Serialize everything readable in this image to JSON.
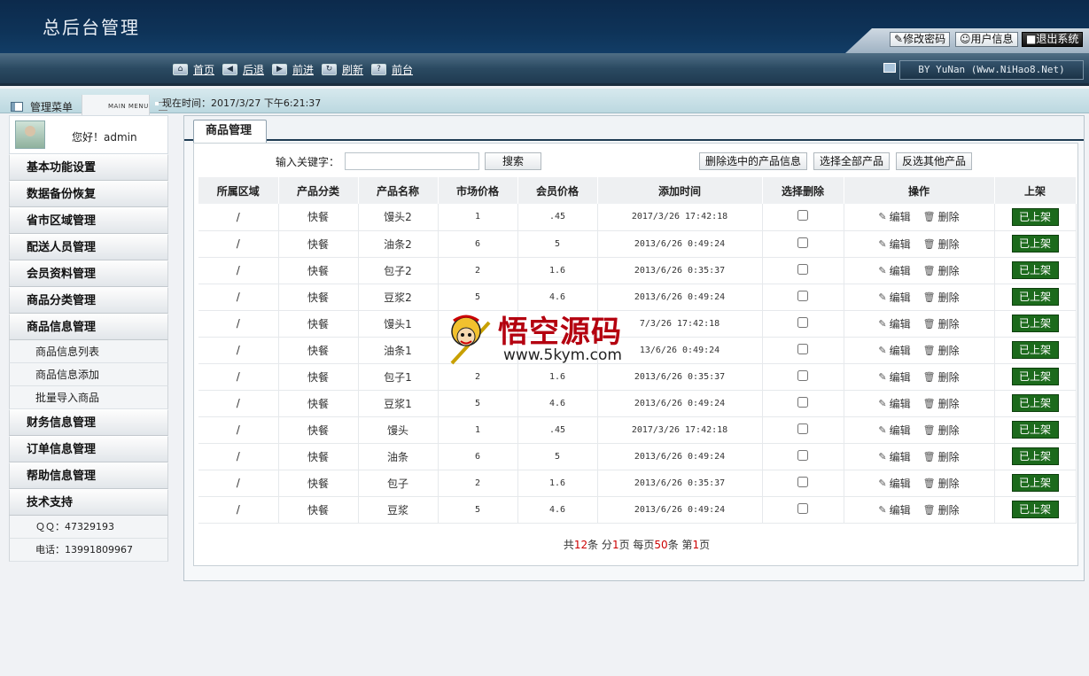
{
  "header": {
    "title": "总后台管理",
    "buttons": [
      "修改密码",
      "用户信息",
      "退出系统"
    ]
  },
  "nav": {
    "items": [
      "首页",
      "后退",
      "前进",
      "刷新",
      "前台"
    ],
    "by": "BY YuNan (Www.NiHao8.Net)"
  },
  "infobar": {
    "menu_title": "管理菜单",
    "menu_sub": "MAIN MENU",
    "now_label": "现在时间：",
    "now_value": "2017/3/27 下午6:21:37"
  },
  "sidebar": {
    "hello": "您好！admin",
    "groups_top": [
      "基本功能设置",
      "数据备份恢复",
      "省市区域管理",
      "配送人员管理",
      "会员资料管理",
      "商品分类管理",
      "商品信息管理"
    ],
    "subitems": [
      "商品信息列表",
      "商品信息添加",
      "批量导入商品"
    ],
    "groups_bottom": [
      "财务信息管理",
      "订单信息管理",
      "帮助信息管理",
      "技术支持"
    ],
    "contacts": [
      "ＱＱ：47329193",
      "电话：13991809967"
    ]
  },
  "main": {
    "tab": "商品管理",
    "search_label": "输入关键字：",
    "search_value": "",
    "search_button": "搜索",
    "actions": [
      "删除选中的产品信息",
      "选择全部产品",
      "反选其他产品"
    ],
    "columns": [
      "所属区域",
      "产品分类",
      "产品名称",
      "市场价格",
      "会员价格",
      "添加时间",
      "选择删除",
      "操作",
      "上架"
    ],
    "edit_label": "编辑",
    "delete_label": "删除",
    "rows": [
      {
        "region": "/",
        "cat": "快餐",
        "name": "馒头2",
        "price": "1",
        "member": ".45",
        "time": "2017/3/26 17:42:18",
        "status": "已上架"
      },
      {
        "region": "/",
        "cat": "快餐",
        "name": "油条2",
        "price": "6",
        "member": "5",
        "time": "2013/6/26 0:49:24",
        "status": "已上架"
      },
      {
        "region": "/",
        "cat": "快餐",
        "name": "包子2",
        "price": "2",
        "member": "1.6",
        "time": "2013/6/26 0:35:37",
        "status": "已上架"
      },
      {
        "region": "/",
        "cat": "快餐",
        "name": "豆浆2",
        "price": "5",
        "member": "4.6",
        "time": "2013/6/26 0:49:24",
        "status": "已上架"
      },
      {
        "region": "/",
        "cat": "快餐",
        "name": "馒头1",
        "price": "",
        "member": "",
        "time": "7/3/26 17:42:18",
        "status": "已上架"
      },
      {
        "region": "/",
        "cat": "快餐",
        "name": "油条1",
        "price": "",
        "member": "",
        "time": "13/6/26 0:49:24",
        "status": "已上架"
      },
      {
        "region": "/",
        "cat": "快餐",
        "name": "包子1",
        "price": "2",
        "member": "1.6",
        "time": "2013/6/26 0:35:37",
        "status": "已上架"
      },
      {
        "region": "/",
        "cat": "快餐",
        "name": "豆浆1",
        "price": "5",
        "member": "4.6",
        "time": "2013/6/26 0:49:24",
        "status": "已上架"
      },
      {
        "region": "/",
        "cat": "快餐",
        "name": "馒头",
        "price": "1",
        "member": ".45",
        "time": "2017/3/26 17:42:18",
        "status": "已上架"
      },
      {
        "region": "/",
        "cat": "快餐",
        "name": "油条",
        "price": "6",
        "member": "5",
        "time": "2013/6/26 0:49:24",
        "status": "已上架"
      },
      {
        "region": "/",
        "cat": "快餐",
        "name": "包子",
        "price": "2",
        "member": "1.6",
        "time": "2013/6/26 0:35:37",
        "status": "已上架"
      },
      {
        "region": "/",
        "cat": "快餐",
        "name": "豆浆",
        "price": "5",
        "member": "4.6",
        "time": "2013/6/26 0:49:24",
        "status": "已上架"
      }
    ],
    "pager": {
      "p1": "共",
      "total": "12",
      "p2": "条 分",
      "pages": "1",
      "p3": "页 每页",
      "per": "50",
      "p4": "条 第",
      "cur": "1",
      "p5": "页"
    }
  },
  "watermark": {
    "cn": "悟空源码",
    "url": "www.5kym.com"
  }
}
